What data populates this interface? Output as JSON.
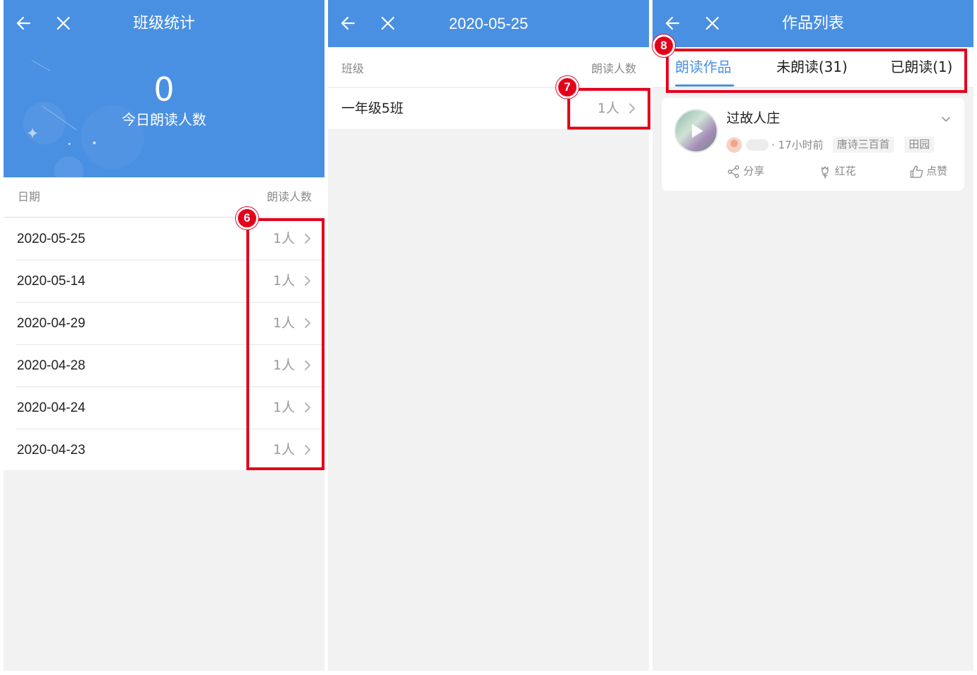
{
  "panel1": {
    "title": "班级统计",
    "today_count": "0",
    "today_label": "今日朗读人数",
    "header_left": "日期",
    "header_right": "朗读人数",
    "rows": [
      {
        "date": "2020-05-25",
        "count": "1人"
      },
      {
        "date": "2020-05-14",
        "count": "1人"
      },
      {
        "date": "2020-04-29",
        "count": "1人"
      },
      {
        "date": "2020-04-28",
        "count": "1人"
      },
      {
        "date": "2020-04-24",
        "count": "1人"
      },
      {
        "date": "2020-04-23",
        "count": "1人"
      }
    ],
    "marker": "6"
  },
  "panel2": {
    "title": "2020-05-25",
    "header_left": "班级",
    "header_right": "朗读人数",
    "row": {
      "class_name": "一年级5班",
      "count": "1人"
    },
    "marker": "7"
  },
  "panel3": {
    "title": "作品列表",
    "tabs": [
      {
        "label": "朗读作品",
        "active": true
      },
      {
        "label": "未朗读(31)",
        "active": false
      },
      {
        "label": "已朗读(1)",
        "active": false
      }
    ],
    "card": {
      "title": "过故人庄",
      "time": "· 17小时前",
      "tags": [
        "唐诗三百首",
        "田园"
      ],
      "actions": {
        "share": "分享",
        "flower": "红花",
        "like": "点赞"
      }
    },
    "marker": "8"
  },
  "colors": {
    "brand_blue": "#4a90e2",
    "annotation_red": "#e3001b",
    "background_gray": "#f2f2f2"
  },
  "icons": {
    "back": "arrow-left-icon",
    "close": "close-icon",
    "chevron": "chevron-right-icon",
    "expand": "chevron-down-icon",
    "share": "share-icon",
    "flower": "flower-icon",
    "like": "thumbs-up-icon"
  }
}
